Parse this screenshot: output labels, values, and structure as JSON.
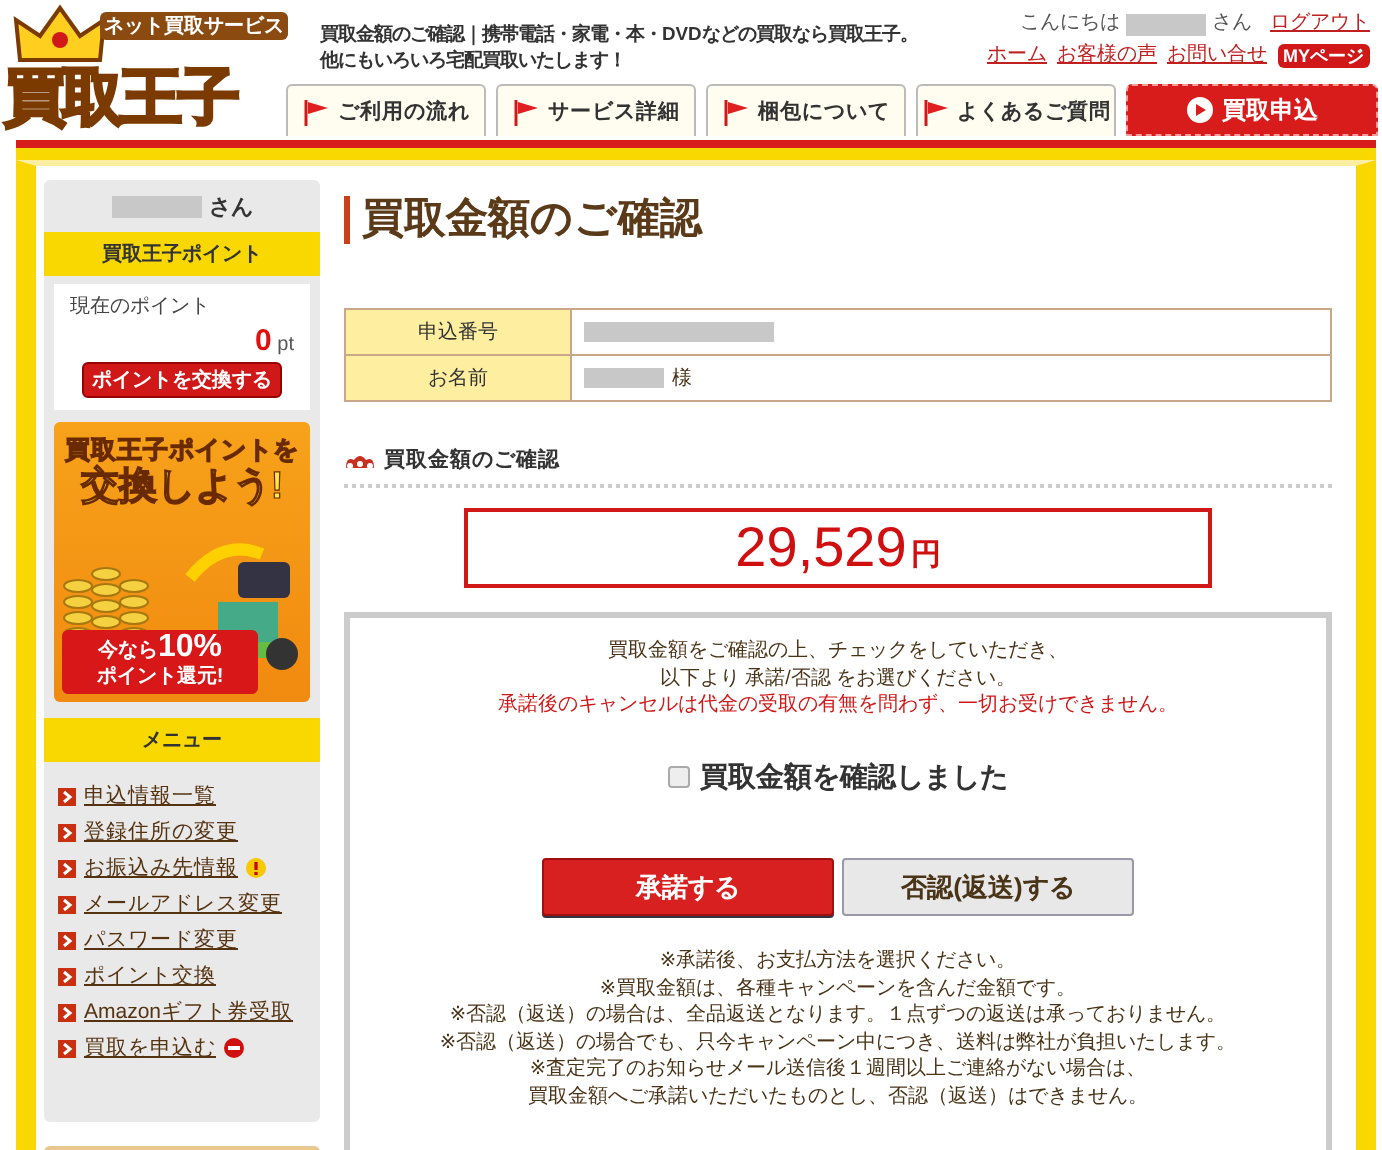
{
  "header": {
    "logo": {
      "tagline": "ネット買取サービス",
      "name": "買取王子"
    },
    "description": [
      "買取金額のご確認｜携帯電話・家電・本・DVDなどの買取なら買取王子。",
      "他にもいろいろ宅配買取いたします！"
    ],
    "greeting": {
      "prefix": "こんにちは",
      "suffix": "さん"
    },
    "logout": "ログアウト",
    "links": [
      "ホーム",
      "お客様の声",
      "お問い合せ"
    ],
    "mypage": "MYページ",
    "nav": [
      {
        "label": "ご利用の流れ",
        "kind": "tab"
      },
      {
        "label": "サービス詳細",
        "kind": "tab"
      },
      {
        "label": "梱包について",
        "kind": "tab"
      },
      {
        "label": "よくあるご質問",
        "kind": "tab"
      },
      {
        "label": "買取申込",
        "kind": "cta"
      }
    ]
  },
  "sidebar": {
    "user_suffix": "さん",
    "points": {
      "title": "買取王子ポイント",
      "label": "現在のポイント",
      "value": "0",
      "unit": "pt",
      "button": "ポイントを交換する"
    },
    "banner": {
      "headline": [
        "買取王子ポイントを",
        "交換しよう!"
      ],
      "offer": [
        "今なら",
        "10%",
        "ポイント還元!"
      ]
    },
    "menu": {
      "title": "メニュー",
      "items": [
        {
          "label": "申込情報一覧",
          "warning": false,
          "blocked": false
        },
        {
          "label": "登録住所の変更",
          "warning": false,
          "blocked": false
        },
        {
          "label": "お振込み先情報",
          "warning": true,
          "blocked": false
        },
        {
          "label": "メールアドレス変更",
          "warning": false,
          "blocked": false
        },
        {
          "label": "パスワード変更",
          "warning": false,
          "blocked": false
        },
        {
          "label": "ポイント交換",
          "warning": false,
          "blocked": false
        },
        {
          "label": "Amazonギフト券受取",
          "warning": false,
          "blocked": false
        },
        {
          "label": "買取を申込む",
          "warning": false,
          "blocked": true
        }
      ]
    }
  },
  "main": {
    "title": "買取金額のご確認",
    "info": [
      {
        "label": "申込番号"
      },
      {
        "label": "お名前",
        "suffix": "様"
      }
    ],
    "section": "買取金額のご確認",
    "amount": {
      "value": "29,529",
      "unit": "円"
    },
    "notice": [
      {
        "text": "買取金額をご確認の上、チェックをしていただき、",
        "kind": "plain"
      },
      {
        "text": "以下より 承諾/否認 をお選びください。",
        "kind": "plain"
      },
      {
        "text": "承諾後のキャンセルは代金の受取の有無を問わず、一切お受けできません。",
        "kind": "warning"
      }
    ],
    "confirm": {
      "label": "買取金額を確認しました",
      "checked": false
    },
    "buttons": [
      {
        "label": "承諾する",
        "kind": "primary"
      },
      {
        "label": "否認(返送)する",
        "kind": "secondary"
      }
    ],
    "notes": [
      "※承諾後、お支払方法を選択ください。",
      "※買取金額は、各種キャンペーンを含んだ金額です。",
      "※否認（返送）の場合は、全品返送となります。１点ずつの返送は承っておりません。",
      "※否認（返送）の場合でも、只今キャンペーン中につき、送料は弊社が負担いたします。",
      "※査定完了のお知らせメール送信後１週間以上ご連絡がない場合は、",
      "買取金額へご承諾いただいたものとし、否認（返送）はできません。"
    ]
  }
}
